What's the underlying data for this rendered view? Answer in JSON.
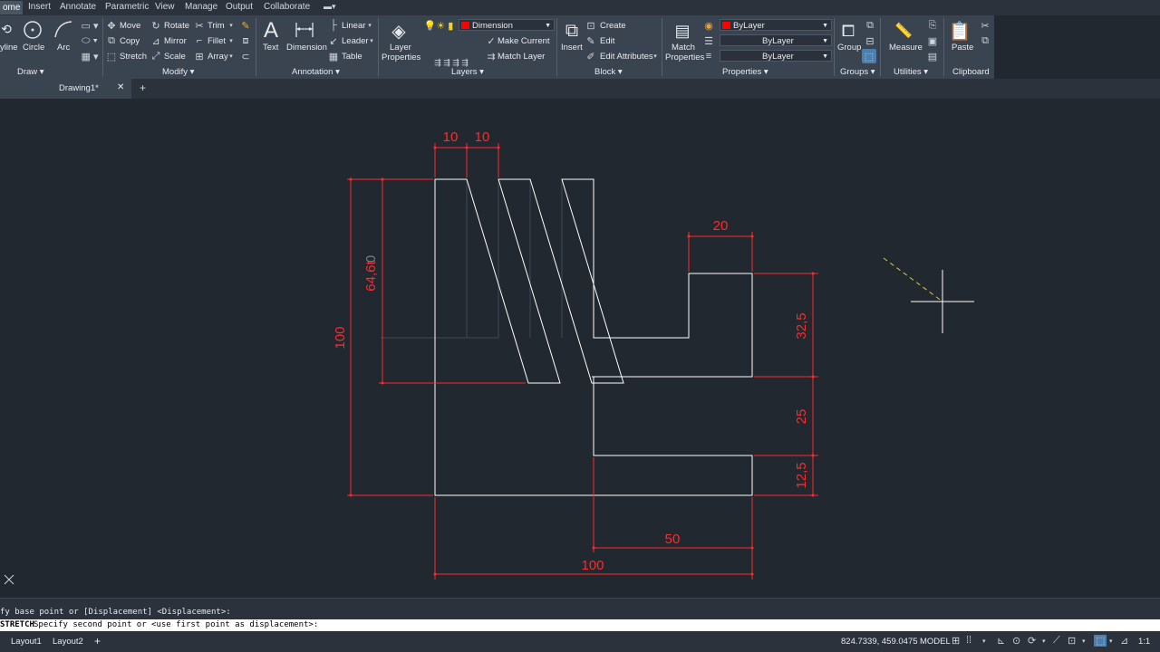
{
  "tabs": [
    "ome",
    "Insert",
    "Annotate",
    "Parametric",
    "View",
    "Manage",
    "Output",
    "Collaborate"
  ],
  "ribbon": {
    "draw": {
      "polyline": "yline",
      "circle": "Circle",
      "arc": "Arc",
      "panel": "Draw ▾"
    },
    "modify": {
      "move": "Move",
      "rotate": "Rotate",
      "trim": "Trim",
      "copy": "Copy",
      "mirror": "Mirror",
      "fillet": "Fillet",
      "stretch": "Stretch",
      "scale": "Scale",
      "array": "Array",
      "panel": "Modify ▾"
    },
    "annotation": {
      "text": "Text",
      "dimension": "Dimension",
      "linear": "Linear",
      "leader": "Leader",
      "table": "Table",
      "panel": "Annotation ▾"
    },
    "layers": {
      "layer_properties_1": "Layer",
      "layer_properties_2": "Properties",
      "current_layer": "Dimension",
      "make_current": "Make Current",
      "match_layer": "Match Layer",
      "panel": "Layers ▾"
    },
    "block": {
      "insert": "Insert",
      "create": "Create",
      "edit": "Edit",
      "edit_attributes": "Edit Attributes",
      "panel": "Block ▾"
    },
    "properties": {
      "match_1": "Match",
      "match_2": "Properties",
      "color": "ByLayer",
      "linetype": "ByLayer",
      "lineweight": "ByLayer",
      "panel": "Properties ▾"
    },
    "groups": {
      "group": "Group",
      "panel": "Groups ▾"
    },
    "utilities": {
      "measure": "Measure",
      "panel": "Utilities ▾"
    },
    "clipboard": {
      "paste": "Paste",
      "panel": "Clipboard"
    }
  },
  "file_tab": {
    "name": "Drawing1*",
    "close": "✕",
    "add": "+"
  },
  "drawing": {
    "dims": {
      "top_a": "10",
      "top_b": "10",
      "right_top": "20",
      "left_height": "100",
      "left_inner": "64,6t",
      "left_inner_ghost": "0",
      "right_a": "32,5",
      "right_b": "25",
      "right_c": "12,5",
      "bottom_a": "50",
      "bottom_b": "100"
    }
  },
  "command": {
    "line1": "fy base point or [Displacement] <Displacement>:",
    "line2_cmd": "STRETCH",
    "line2_text": "Specify second point or <use first point as displacement>:"
  },
  "status": {
    "layout1": "Layout1",
    "layout2": "Layout2",
    "add": "+",
    "coords": "824.7339, 459.0475",
    "model": "MODEL",
    "scale": "1:1"
  },
  "colors": {
    "dimension": "#ff2a2a",
    "geometry": "#ffffff",
    "canvas": "#212830",
    "ribbon": "#3a4350"
  }
}
